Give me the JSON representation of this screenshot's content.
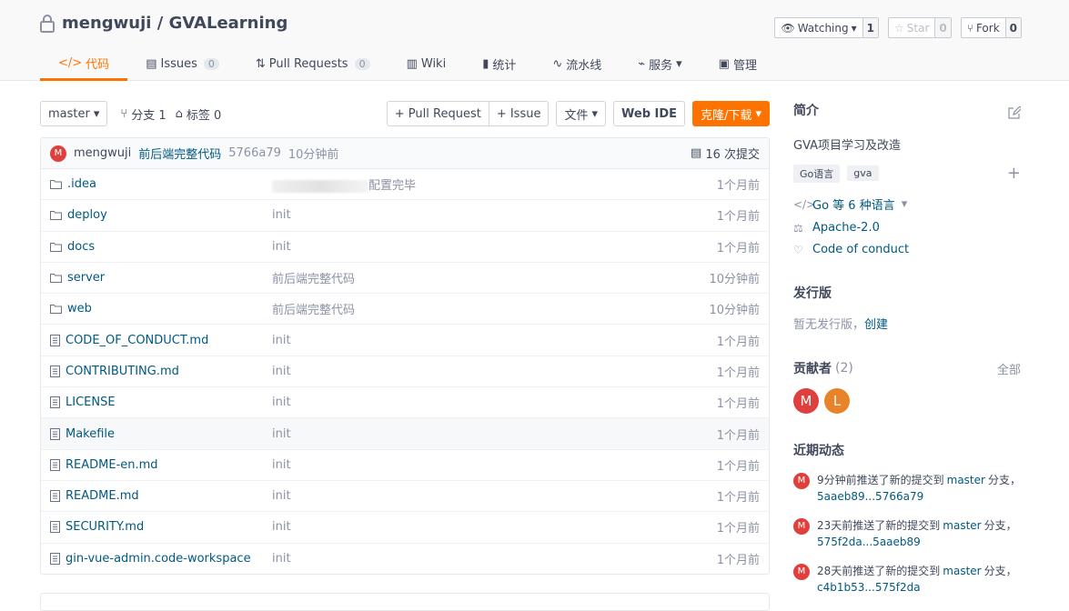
{
  "repo": {
    "owner": "mengwuji",
    "separator": " / ",
    "name": "GVALearning"
  },
  "actions": [
    {
      "label": "Watching",
      "count": "1"
    },
    {
      "label": "Star",
      "count": "0"
    },
    {
      "label": "Fork",
      "count": "0"
    }
  ],
  "tabs": [
    {
      "label": "代码"
    },
    {
      "label": "Issues",
      "badge": "0"
    },
    {
      "label": "Pull Requests",
      "badge": "0"
    },
    {
      "label": "Wiki"
    },
    {
      "label": "统计"
    },
    {
      "label": "流水线"
    },
    {
      "label": "服务"
    },
    {
      "label": "管理"
    }
  ],
  "toolbar": {
    "branch": "master",
    "branches": "分支 1",
    "tags": "标签 0",
    "pull_request": "+ Pull Request",
    "issue": "+ Issue",
    "file": "文件",
    "webide": "Web IDE",
    "clone": "克隆/下载"
  },
  "commit": {
    "avatar": "M",
    "author": "mengwuji",
    "message": "前后端完整代码",
    "sha": "5766a79",
    "time": "10分钟前",
    "count": "16 次提交"
  },
  "files": [
    {
      "name": ".idea",
      "type": "dir",
      "msg": "配置完毕",
      "time": "1个月前"
    },
    {
      "name": "deploy",
      "type": "dir",
      "msg": "init",
      "time": "1个月前"
    },
    {
      "name": "docs",
      "type": "dir",
      "msg": "init",
      "time": "1个月前"
    },
    {
      "name": "server",
      "type": "dir",
      "msg": "前后端完整代码",
      "time": "10分钟前"
    },
    {
      "name": "web",
      "type": "dir",
      "msg": "前后端完整代码",
      "time": "10分钟前"
    },
    {
      "name": "CODE_OF_CONDUCT.md",
      "type": "file",
      "msg": "init",
      "time": "1个月前"
    },
    {
      "name": "CONTRIBUTING.md",
      "type": "file",
      "msg": "init",
      "time": "1个月前"
    },
    {
      "name": "LICENSE",
      "type": "file",
      "msg": "init",
      "time": "1个月前"
    },
    {
      "name": "Makefile",
      "type": "file",
      "msg": "init",
      "time": "1个月前"
    },
    {
      "name": "README-en.md",
      "type": "file",
      "msg": "init",
      "time": "1个月前"
    },
    {
      "name": "README.md",
      "type": "file",
      "msg": "init",
      "time": "1个月前"
    },
    {
      "name": "SECURITY.md",
      "type": "file",
      "msg": "init",
      "time": "1个月前"
    },
    {
      "name": "gin-vue-admin.code-workspace",
      "type": "file",
      "msg": "init",
      "time": "1个月前"
    }
  ],
  "sidebar": {
    "intro_title": "简介",
    "description": "GVA项目学习及改造",
    "topics": [
      "Go语言",
      "gva"
    ],
    "languages": "Go 等 6 种语言",
    "license": "Apache-2.0",
    "conduct": "Code of conduct",
    "release_title": "发行版",
    "release_text": "暂无发行版，",
    "release_create": "创建",
    "contrib_title": "贡献者",
    "contrib_count": "(2)",
    "contrib_all": "全部",
    "contributors": [
      {
        "initial": "M",
        "color": "#e0403d"
      },
      {
        "initial": "L",
        "color": "#e8832a"
      }
    ],
    "activity_title": "近期动态",
    "events": [
      {
        "avatar": "M",
        "text": "9分钟前推送了新的提交到",
        "branch": "master",
        "suffix": "分支，",
        "range": "5aaeb89...5766a79"
      },
      {
        "avatar": "M",
        "text": "23天前推送了新的提交到",
        "branch": "master",
        "suffix": "分支，",
        "range": "575f2da...5aaeb89"
      },
      {
        "avatar": "M",
        "text": "28天前推送了新的提交到",
        "branch": "master",
        "suffix": "分支，",
        "range": "c4b1b53...575f2da"
      }
    ]
  }
}
